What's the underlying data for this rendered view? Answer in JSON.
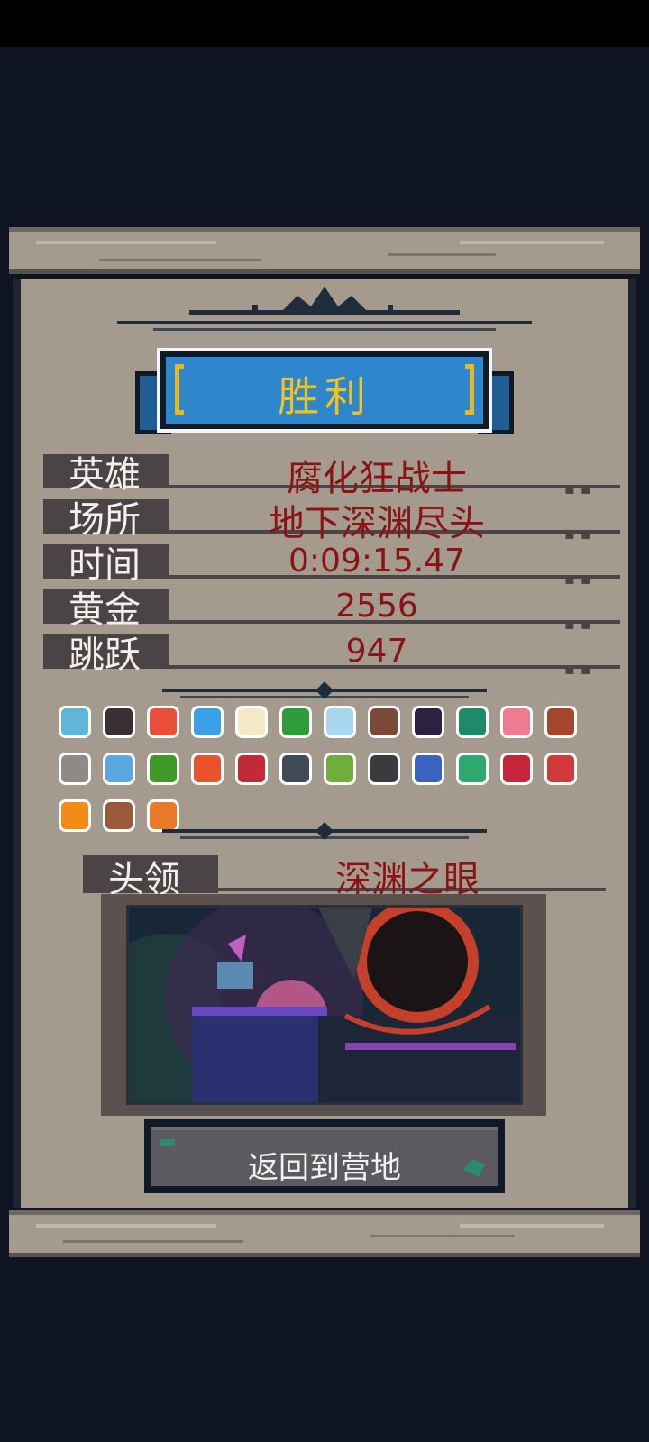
{
  "title": "胜利",
  "stats": [
    {
      "label": "英雄",
      "value": "腐化狂战士"
    },
    {
      "label": "场所",
      "value": "地下深渊尽头"
    },
    {
      "label": "时间",
      "value": "0:09:15.47"
    },
    {
      "label": "黄金",
      "value": "2556"
    },
    {
      "label": "跳跃",
      "value": "947"
    }
  ],
  "items": [
    {
      "icon": "crystal-cross-icon",
      "color": "#5fb6d9"
    },
    {
      "icon": "dark-sword-icon",
      "color": "#3a2f33"
    },
    {
      "icon": "holy-cross-icon",
      "color": "#e8503a"
    },
    {
      "icon": "blue-heart-icon",
      "color": "#3aa0e8"
    },
    {
      "icon": "fried-egg-icon",
      "color": "#f5e9c8"
    },
    {
      "icon": "four-leaf-clover-icon",
      "color": "#2f9c3a"
    },
    {
      "icon": "ghost-icon",
      "color": "#a8d8f0"
    },
    {
      "icon": "potion-sack-icon",
      "color": "#7a4a36"
    },
    {
      "icon": "shadow-orb-icon",
      "color": "#2b2240"
    },
    {
      "icon": "green-orb-icon",
      "color": "#1e8a6a"
    },
    {
      "icon": "pink-gem-icon",
      "color": "#ef7b93"
    },
    {
      "icon": "treasure-basket-icon",
      "color": "#a4452c"
    },
    {
      "icon": "dagger-icon",
      "color": "#8f8a86"
    },
    {
      "icon": "cloud-boot-icon",
      "color": "#5aa8e0"
    },
    {
      "icon": "slime-icon",
      "color": "#3f9a28"
    },
    {
      "icon": "sun-tile-icon",
      "color": "#e8522c"
    },
    {
      "icon": "heart-anvil-icon",
      "color": "#c22a3a"
    },
    {
      "icon": "anvil-icon",
      "color": "#3e4a56"
    },
    {
      "icon": "leaf-icon",
      "color": "#6fae3a"
    },
    {
      "icon": "stone-icon",
      "color": "#3b3a3e"
    },
    {
      "icon": "flame-sword-icon",
      "color": "#3a64c0"
    },
    {
      "icon": "clover-gem-icon",
      "color": "#2ea86f"
    },
    {
      "icon": "broken-heart-icon",
      "color": "#c7263a"
    },
    {
      "icon": "red-potion-icon",
      "color": "#d23a3a"
    },
    {
      "icon": "fire-orb-icon",
      "color": "#f28a1a"
    },
    {
      "icon": "meat-icon",
      "color": "#9a5a3a"
    },
    {
      "icon": "fire-arrow-icon",
      "color": "#e87a2a"
    }
  ],
  "boss": {
    "label": "头领",
    "value": "深渊之眼"
  },
  "return_button": "返回到营地"
}
